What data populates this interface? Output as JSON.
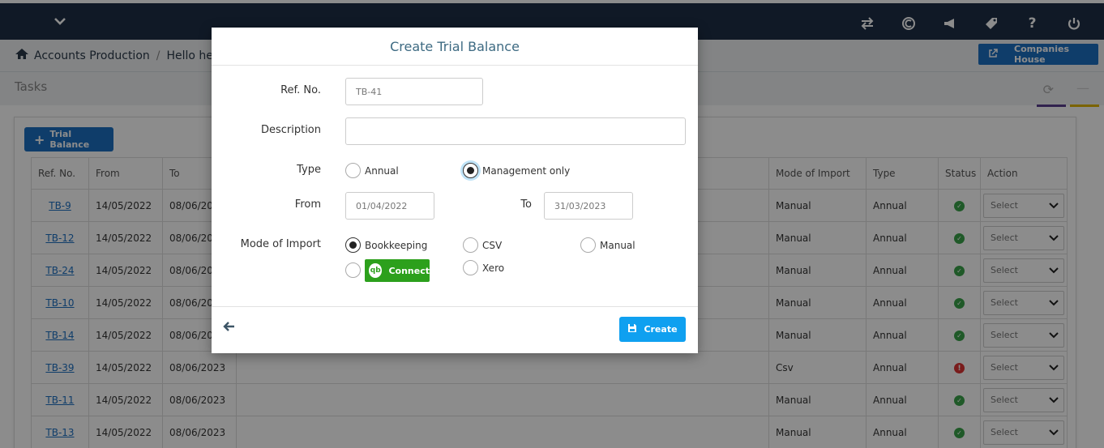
{
  "breadcrumb": {
    "home": "Accounts Production",
    "current": "Hello hell"
  },
  "header": {
    "companies_house": "Companies House"
  },
  "tasks": {
    "title": "Tasks",
    "trial_balance_button": "Trial Balance"
  },
  "table": {
    "headers": [
      "Ref. No.",
      "From",
      "To",
      "Mode of Import",
      "Type",
      "Status",
      "Action"
    ],
    "rows": [
      {
        "ref": "TB-9",
        "from": "14/05/2022",
        "to": "08/06/20",
        "mode": "Manual",
        "type": "Annual",
        "status": "ok",
        "action": "Select"
      },
      {
        "ref": "TB-12",
        "from": "14/05/2022",
        "to": "08/06/20",
        "mode": "Manual",
        "type": "Annual",
        "status": "ok",
        "action": "Select"
      },
      {
        "ref": "TB-24",
        "from": "14/05/2022",
        "to": "08/06/20",
        "mode": "Manual",
        "type": "Annual",
        "status": "ok",
        "action": "Select"
      },
      {
        "ref": "TB-10",
        "from": "14/05/2022",
        "to": "08/06/20",
        "mode": "Manual",
        "type": "Annual",
        "status": "ok",
        "action": "Select"
      },
      {
        "ref": "TB-14",
        "from": "14/05/2022",
        "to": "08/06/20",
        "mode": "Manual",
        "type": "Annual",
        "status": "ok",
        "action": "Select"
      },
      {
        "ref": "TB-39",
        "from": "14/05/2022",
        "to": "08/06/2023",
        "mode": "Csv",
        "type": "Annual",
        "status": "error",
        "action": "Select"
      },
      {
        "ref": "TB-11",
        "from": "14/05/2022",
        "to": "08/06/2023",
        "mode": "Manual",
        "type": "Annual",
        "status": "ok",
        "action": "Select"
      },
      {
        "ref": "TB-13",
        "from": "14/05/2022",
        "to": "08/06/2023",
        "mode": "Manual",
        "type": "Annual",
        "status": "ok",
        "action": "Select"
      }
    ]
  },
  "modal": {
    "title": "Create Trial Balance",
    "ref_label": "Ref. No.",
    "ref_value": "TB-41",
    "description_label": "Description",
    "description_value": "",
    "type_label": "Type",
    "type_options": [
      "Annual",
      "Management only"
    ],
    "type_selected": "Management only",
    "from_label": "From",
    "from_value": "01/04/2022",
    "to_label": "To",
    "to_value": "31/03/2023",
    "mode_label": "Mode of Import",
    "mode_options": [
      "Bookkeeping",
      "CSV",
      "Manual",
      "Connect",
      "Xero"
    ],
    "mode_selected": "Bookkeeping",
    "qb_logo": "qb",
    "create_label": "Create"
  },
  "colors": {
    "topbar": "#1e2f45",
    "primary": "#1d6fc2",
    "create": "#0fa0f0",
    "quickbooks": "#2ca01c",
    "status_ok": "#3aa34a",
    "status_error": "#dd3333"
  }
}
